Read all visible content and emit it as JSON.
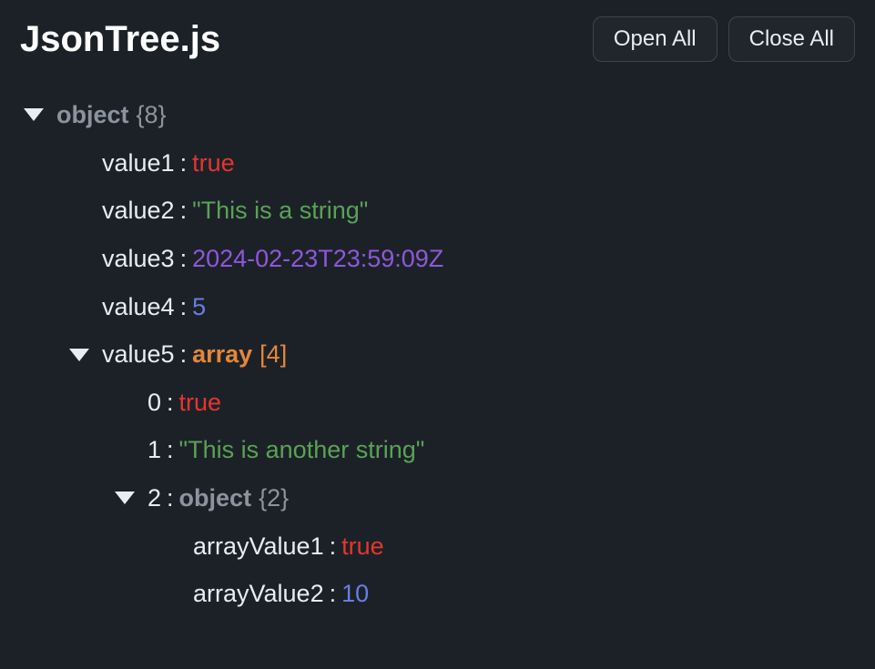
{
  "header": {
    "title": "JsonTree.js",
    "openAll": "Open All",
    "closeAll": "Close All"
  },
  "root": {
    "typeLabel": "object",
    "count": "{8}"
  },
  "items": {
    "value1": {
      "key": "value1",
      "colon": ":",
      "val": "true"
    },
    "value2": {
      "key": "value2",
      "colon": ":",
      "val": "\"This is a string\""
    },
    "value3": {
      "key": "value3",
      "colon": ":",
      "val": "2024-02-23T23:59:09Z"
    },
    "value4": {
      "key": "value4",
      "colon": ":",
      "val": "5"
    },
    "value5": {
      "key": "value5",
      "colon": ":",
      "typeLabel": "array",
      "count": "[4]"
    },
    "arr0": {
      "key": "0",
      "colon": ":",
      "val": "true"
    },
    "arr1": {
      "key": "1",
      "colon": ":",
      "val": "\"This is another string\""
    },
    "arr2": {
      "key": "2",
      "colon": ":",
      "typeLabel": "object",
      "count": "{2}"
    },
    "arrayValue1": {
      "key": "arrayValue1",
      "colon": ":",
      "val": "true"
    },
    "arrayValue2": {
      "key": "arrayValue2",
      "colon": ":",
      "val": "10"
    }
  }
}
